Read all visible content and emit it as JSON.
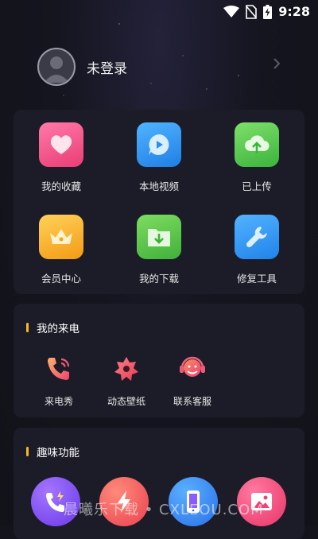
{
  "status_bar": {
    "time": "9:28"
  },
  "profile": {
    "name": "未登录"
  },
  "main_grid": {
    "items": [
      {
        "label": "我的收藏",
        "icon": "heart-icon",
        "color": "#f04f86"
      },
      {
        "label": "本地视频",
        "icon": "play-bubble-icon",
        "color": "#2a93f0"
      },
      {
        "label": "已上传",
        "icon": "cloud-upload-icon",
        "color": "#49c74a"
      },
      {
        "label": "会员中心",
        "icon": "crown-icon",
        "color": "#f5ad22"
      },
      {
        "label": "我的下载",
        "icon": "folder-download-icon",
        "color": "#56c63f"
      },
      {
        "label": "修复工具",
        "icon": "wrench-icon",
        "color": "#2f95ef"
      }
    ]
  },
  "calls_section": {
    "title": "我的来电",
    "items": [
      {
        "label": "来电秀",
        "icon": "phone-ringing-icon"
      },
      {
        "label": "动态壁纸",
        "icon": "flower-icon"
      },
      {
        "label": "联系客服",
        "icon": "headset-icon"
      }
    ]
  },
  "fun_section": {
    "title": "趣味功能",
    "items": [
      {
        "icon": "phone-charge-icon",
        "color": "#7a4bf0"
      },
      {
        "icon": "lightning-icon",
        "color": "#f25757"
      },
      {
        "icon": "phone-screen-icon",
        "color": "#2a8cf0"
      },
      {
        "icon": "picture-icon",
        "color": "#f0407a"
      }
    ]
  },
  "watermark": "晨曦乐下载 • CXLEOU.COM"
}
